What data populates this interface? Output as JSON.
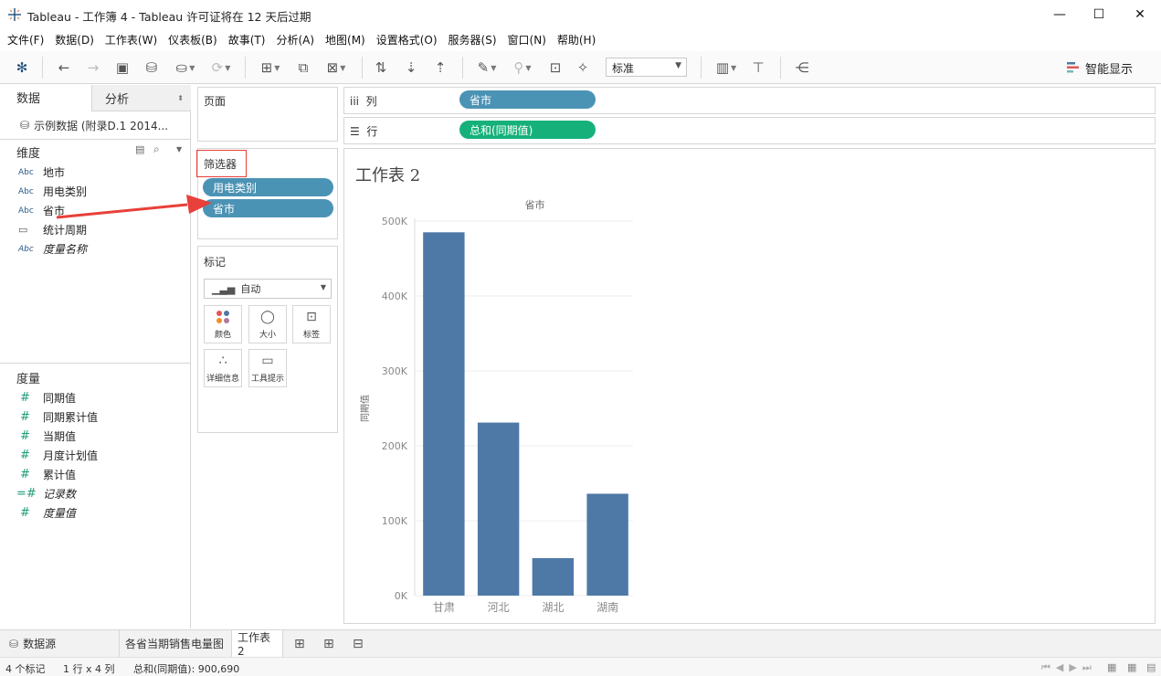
{
  "window": {
    "title": "Tableau - 工作簿 4 - Tableau 许可证将在 12 天后过期",
    "minimize": "—",
    "maximize": "☐",
    "close": "✕"
  },
  "menu": [
    "文件(F)",
    "数据(D)",
    "工作表(W)",
    "仪表板(B)",
    "故事(T)",
    "分析(A)",
    "地图(M)",
    "设置格式(O)",
    "服务器(S)",
    "窗口(N)",
    "帮助(H)"
  ],
  "toolbar": {
    "fit_select": "标准",
    "smart_show": "智能显示"
  },
  "data_pane": {
    "tab_data": "数据",
    "tab_analysis": "分析",
    "datasource": "示例数据 (附录D.1 2014...",
    "dimensions_title": "维度",
    "dimensions": [
      {
        "type": "Abc",
        "label": "地市",
        "italic": false
      },
      {
        "type": "Abc",
        "label": "用电类别",
        "italic": false
      },
      {
        "type": "Abc",
        "label": "省市",
        "italic": false
      },
      {
        "type": "date",
        "label": "统计周期",
        "italic": false
      },
      {
        "type": "Abc",
        "label": "度量名称",
        "italic": true
      }
    ],
    "measures_title": "度量",
    "measures": [
      {
        "label": "同期值",
        "italic": false
      },
      {
        "label": "同期累计值",
        "italic": false
      },
      {
        "label": "当期值",
        "italic": false
      },
      {
        "label": "月度计划值",
        "italic": false
      },
      {
        "label": "累计值",
        "italic": false
      },
      {
        "label": "记录数",
        "italic": true
      },
      {
        "label": "度量值",
        "italic": true
      }
    ]
  },
  "pages_card": {
    "title": "页面"
  },
  "filters_card": {
    "title": "筛选器",
    "pills": [
      "用电类别",
      "省市"
    ]
  },
  "marks_card": {
    "title": "标记",
    "mark_type": "自动",
    "buttons": [
      {
        "label": "颜色",
        "icon": "color-icon"
      },
      {
        "label": "大小",
        "icon": "size-icon"
      },
      {
        "label": "标签",
        "icon": "label-icon"
      },
      {
        "label": "详细信息",
        "icon": "detail-icon"
      },
      {
        "label": "工具提示",
        "icon": "tooltip-icon"
      }
    ]
  },
  "columns_shelf": {
    "label": "列",
    "pill": "省市"
  },
  "rows_shelf": {
    "label": "行",
    "pill": "总和(同期值)"
  },
  "sheet": {
    "title": "工作表 2"
  },
  "chart_data": {
    "type": "bar",
    "title": "省市",
    "categories": [
      "甘肃",
      "河北",
      "湖北",
      "湖南"
    ],
    "values": [
      485000,
      231000,
      50000,
      136000
    ],
    "ylabel": "同期值",
    "ylim": [
      0,
      500000
    ],
    "yticks": [
      0,
      100000,
      200000,
      300000,
      400000,
      500000
    ],
    "ytick_labels": [
      "0K",
      "100K",
      "200K",
      "300K",
      "400K",
      "500K"
    ],
    "bar_color": "#4e79a7",
    "grid": true
  },
  "bottom_tabs": [
    "数据源",
    "各省当期销售电量图",
    "工作表 2"
  ],
  "status": {
    "marks": "4 个标记",
    "rows_cols": "1 行 x 4 列",
    "sum": "总和(同期值): 900,690"
  },
  "colors": {
    "pill_blue": "#4b93b5",
    "pill_green": "#16b17b",
    "annotation": "#e8403a"
  }
}
